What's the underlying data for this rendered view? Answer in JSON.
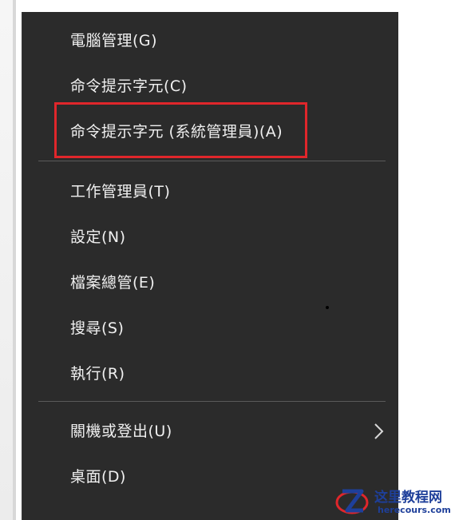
{
  "menu": {
    "items": [
      {
        "label": "電腦管理(G)"
      },
      {
        "label": "命令提示字元(C)"
      },
      {
        "label": "命令提示字元 (系統管理員)(A)"
      },
      {
        "label": "工作管理員(T)"
      },
      {
        "label": "設定(N)"
      },
      {
        "label": "檔案總管(E)"
      },
      {
        "label": "搜尋(S)"
      },
      {
        "label": "執行(R)"
      },
      {
        "label": "關機或登出(U)"
      },
      {
        "label": "桌面(D)"
      }
    ]
  },
  "icons": {
    "submenu": "chevron-right-icon",
    "watermark_logo": "site-logo-icon"
  },
  "colors": {
    "menu_bg": "#2b2b2b",
    "text": "#f0f0f0",
    "highlight_border": "#e0262b",
    "watermark": "#1e3f9a"
  },
  "watermark": {
    "title": "这里教程网",
    "url": "herecours.com"
  }
}
